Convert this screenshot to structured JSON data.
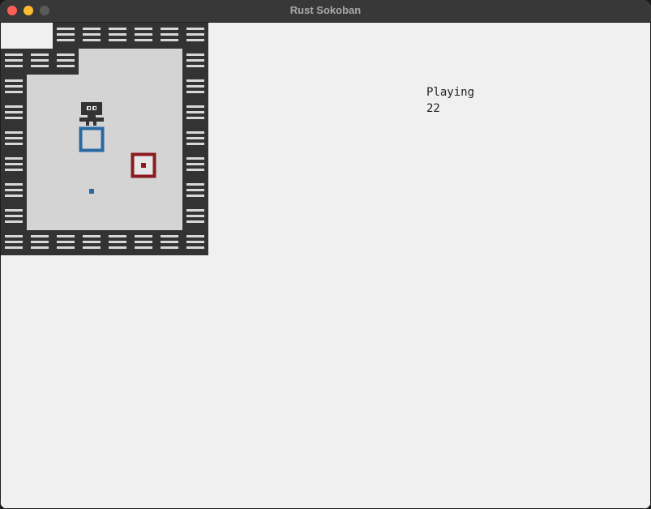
{
  "window": {
    "title": "Rust Sokoban",
    "controls": [
      "close-button",
      "minimize-button",
      "maximize-button"
    ]
  },
  "game": {
    "state": "Playing",
    "steps": "22"
  },
  "level": {
    "tile_kinds": {
      "W": "wall",
      ".": "floor",
      " ": "empty"
    },
    "rows": [
      "  WWWWWW",
      "WWW....W",
      "W......W",
      "W......W",
      "W......W",
      "W......W",
      "W......W",
      "W......W",
      "WWWWWWWW"
    ],
    "entities": [
      {
        "kind": "player",
        "row": 3,
        "col": 3
      },
      {
        "kind": "blue-box-spot",
        "row": 4,
        "col": 3
      },
      {
        "kind": "red-box-on-spot",
        "row": 5,
        "col": 5
      },
      {
        "kind": "blue-dot",
        "row": 6,
        "col": 3
      }
    ]
  },
  "colors": {
    "wall": "#333333",
    "wall_brick": "#d8d8d8",
    "floor": "#d4d4d4",
    "player": "#333333",
    "blue": "#2a6aa3",
    "red": "#8c1c22",
    "background": "#f0f0f0"
  }
}
